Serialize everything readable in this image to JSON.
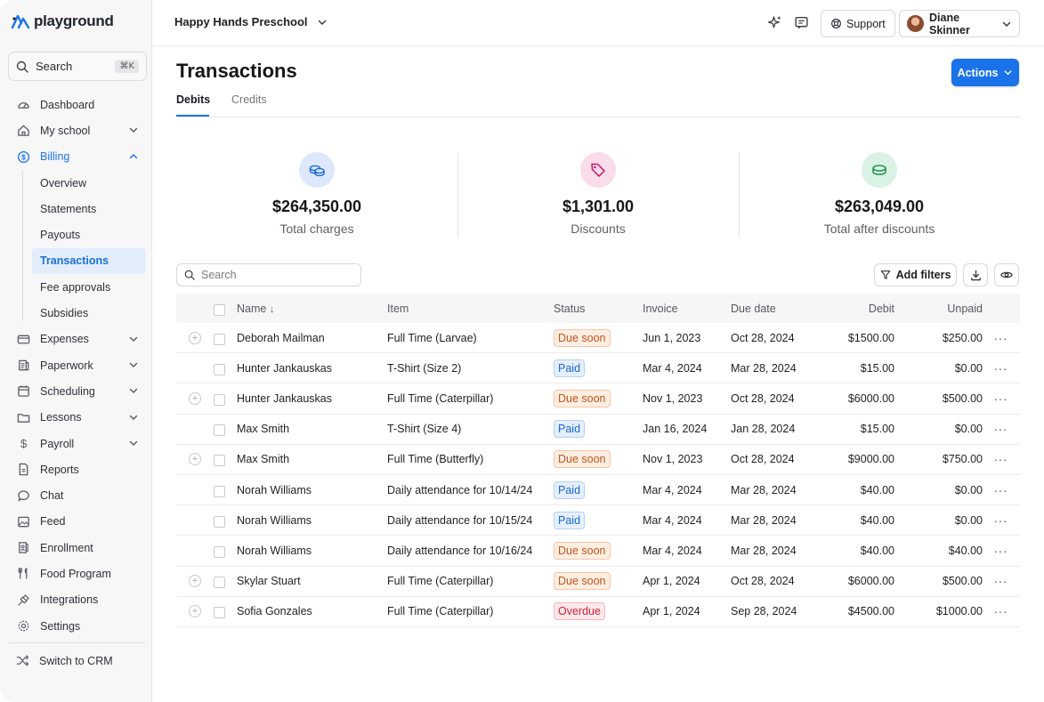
{
  "app": {
    "logo_text": "playground"
  },
  "sidebar": {
    "search_label": "Search",
    "search_shortcut": "⌘K",
    "items": [
      {
        "label": "Dashboard",
        "icon": "dashboard-icon"
      },
      {
        "label": "My school",
        "icon": "home-icon",
        "expandable": true
      },
      {
        "label": "Billing",
        "icon": "dollar-circle-icon",
        "expanded": true
      }
    ],
    "billing_sub": [
      "Overview",
      "Statements",
      "Payouts",
      "Transactions",
      "Fee approvals",
      "Subsidies"
    ],
    "billing_active": "Transactions",
    "items_after": [
      {
        "label": "Expenses",
        "icon": "card-icon",
        "expandable": true
      },
      {
        "label": "Paperwork",
        "icon": "paperwork-icon",
        "expandable": true
      },
      {
        "label": "Scheduling",
        "icon": "calendar-icon",
        "expandable": true
      },
      {
        "label": "Lessons",
        "icon": "folder-icon",
        "expandable": true
      },
      {
        "label": "Payroll",
        "icon": "dollar-icon",
        "expandable": true
      },
      {
        "label": "Reports",
        "icon": "report-icon"
      },
      {
        "label": "Chat",
        "icon": "chat-icon"
      },
      {
        "label": "Feed",
        "icon": "image-icon"
      },
      {
        "label": "Enrollment",
        "icon": "enrollment-icon"
      },
      {
        "label": "Food Program",
        "icon": "fork-knife-icon"
      },
      {
        "label": "Integrations",
        "icon": "plug-icon"
      },
      {
        "label": "Settings",
        "icon": "gear-icon"
      }
    ],
    "switch_crm": "Switch to CRM"
  },
  "topbar": {
    "school_name": "Happy Hands Preschool",
    "support_label": "Support",
    "user_name": "Diane Skinner"
  },
  "page": {
    "title": "Transactions",
    "actions_label": "Actions",
    "tabs": [
      "Debits",
      "Credits"
    ],
    "active_tab": "Debits"
  },
  "stats": [
    {
      "amount": "$264,350.00",
      "caption": "Total charges",
      "icon": "coins-icon",
      "bg": "#dde9fb",
      "fg": "#1a67d2"
    },
    {
      "amount": "$1,301.00",
      "caption": "Discounts",
      "icon": "tag-icon",
      "bg": "#fbdcea",
      "fg": "#c2186a"
    },
    {
      "amount": "$263,049.00",
      "caption": "Total after discounts",
      "icon": "coin-icon",
      "bg": "#d9f2e3",
      "fg": "#1e8f4e"
    }
  ],
  "table": {
    "search_placeholder": "Search",
    "filters_label": "Add filters",
    "columns": {
      "name": "Name",
      "item": "Item",
      "status": "Status",
      "invoice": "Invoice",
      "due": "Due date",
      "debit": "Debit",
      "unpaid": "Unpaid"
    },
    "rows": [
      {
        "name": "Deborah Mailman",
        "item": "Full Time (Larvae)",
        "status": "Due soon",
        "status_type": "due",
        "invoice": "Jun 1, 2023",
        "due": "Oct 28, 2024",
        "debit": "$1500.00",
        "unpaid": "$250.00",
        "expandable": true
      },
      {
        "name": "Hunter Jankauskas",
        "item": "T-Shirt (Size 2)",
        "status": "Paid",
        "status_type": "paid",
        "invoice": "Mar 4, 2024",
        "due": "Mar 28, 2024",
        "debit": "$15.00",
        "unpaid": "$0.00",
        "expandable": false
      },
      {
        "name": "Hunter Jankauskas",
        "item": "Full Time (Caterpillar)",
        "status": "Due soon",
        "status_type": "due",
        "invoice": "Nov 1, 2023",
        "due": "Oct 28, 2024",
        "debit": "$6000.00",
        "unpaid": "$500.00",
        "expandable": true
      },
      {
        "name": "Max Smith",
        "item": "T-Shirt (Size 4)",
        "status": "Paid",
        "status_type": "paid",
        "invoice": "Jan 16, 2024",
        "due": "Jan 28, 2024",
        "debit": "$15.00",
        "unpaid": "$0.00",
        "expandable": false
      },
      {
        "name": "Max Smith",
        "item": "Full Time (Butterfly)",
        "status": "Due soon",
        "status_type": "due",
        "invoice": "Nov 1, 2023",
        "due": "Oct 28, 2024",
        "debit": "$9000.00",
        "unpaid": "$750.00",
        "expandable": true
      },
      {
        "name": "Norah Williams",
        "item": "Daily attendance for 10/14/24",
        "status": "Paid",
        "status_type": "paid",
        "invoice": "Mar 4, 2024",
        "due": "Mar 28, 2024",
        "debit": "$40.00",
        "unpaid": "$0.00",
        "expandable": false
      },
      {
        "name": "Norah Williams",
        "item": "Daily attendance for 10/15/24",
        "status": "Paid",
        "status_type": "paid",
        "invoice": "Mar 4, 2024",
        "due": "Mar 28, 2024",
        "debit": "$40.00",
        "unpaid": "$0.00",
        "expandable": false
      },
      {
        "name": "Norah Williams",
        "item": "Daily attendance for 10/16/24",
        "status": "Due soon",
        "status_type": "due",
        "invoice": "Mar 4, 2024",
        "due": "Mar 28, 2024",
        "debit": "$40.00",
        "unpaid": "$40.00",
        "expandable": false
      },
      {
        "name": "Skylar Stuart",
        "item": "Full Time (Caterpillar)",
        "status": "Due soon",
        "status_type": "due",
        "invoice": "Apr 1, 2024",
        "due": "Oct 28, 2024",
        "debit": "$6000.00",
        "unpaid": "$500.00",
        "expandable": true
      },
      {
        "name": "Sofia Gonzales",
        "item": "Full Time (Caterpillar)",
        "status": "Overdue",
        "status_type": "over",
        "invoice": "Apr 1, 2024",
        "due": "Sep 28, 2024",
        "debit": "$4500.00",
        "unpaid": "$1000.00",
        "expandable": true
      }
    ]
  },
  "colors": {
    "accent": "#1a73e8"
  }
}
